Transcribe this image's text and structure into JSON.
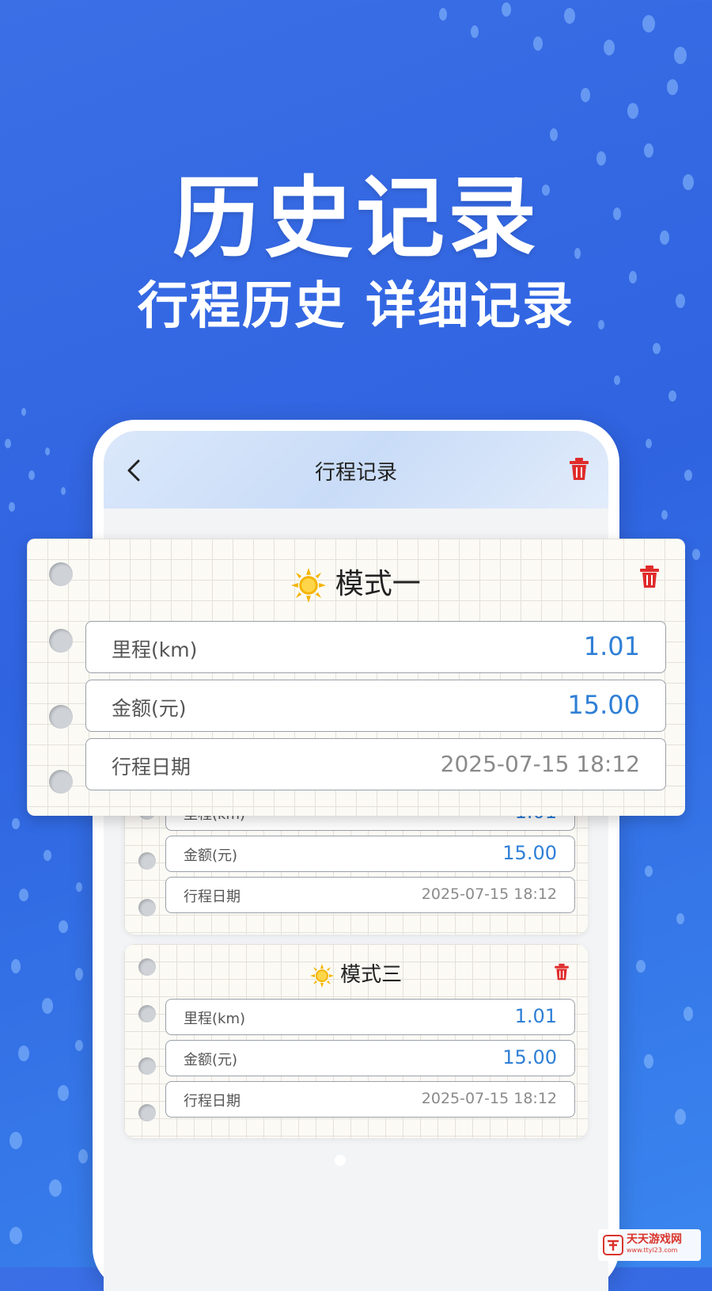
{
  "hero": {
    "title": "历史记录",
    "subtitle": "行程历史 详细记录"
  },
  "phone": {
    "nav": {
      "title": "行程记录",
      "back_icon": "chevron-left-icon",
      "delete_icon": "trash-icon"
    }
  },
  "cards": [
    {
      "mode": "模式一",
      "icon": "sun-icon",
      "rows": [
        {
          "label": "里程(km)",
          "value": "1.01"
        },
        {
          "label": "金额(元)",
          "value": "15.00"
        },
        {
          "label": "行程日期",
          "value": "2025-07-15 18:12"
        }
      ]
    },
    {
      "mode": "",
      "rows": [
        {
          "label": "里程(km)",
          "value": "1.01"
        },
        {
          "label": "金额(元)",
          "value": "15.00"
        },
        {
          "label": "行程日期",
          "value": "2025-07-15 18:12"
        }
      ]
    },
    {
      "mode": "模式三",
      "icon": "sun-icon",
      "rows": [
        {
          "label": "里程(km)",
          "value": "1.01"
        },
        {
          "label": "金额(元)",
          "value": "15.00"
        },
        {
          "label": "行程日期",
          "value": "2025-07-15 18:12"
        }
      ]
    }
  ],
  "watermark": {
    "text": "天天游戏网",
    "url": "www.ttyl23.com"
  },
  "colors": {
    "background": "#2f63e0",
    "value": "#2f7fd6",
    "delete": "#e02b2b"
  }
}
